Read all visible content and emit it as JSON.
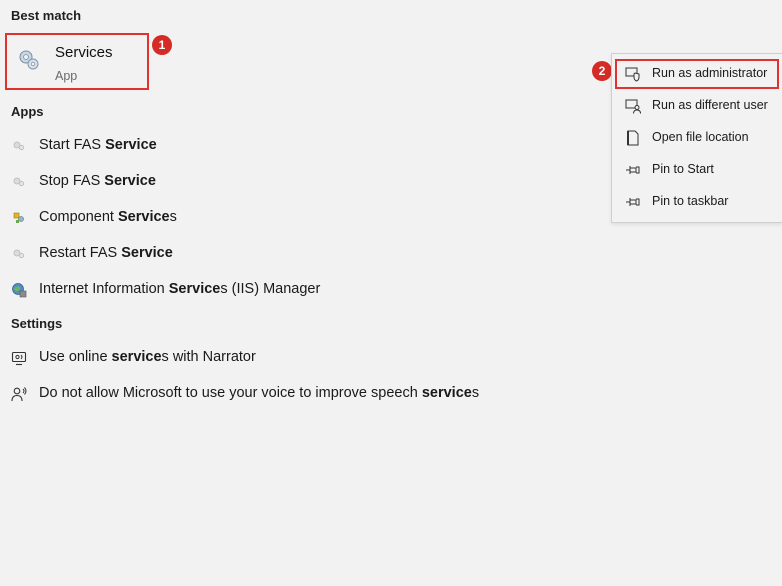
{
  "headers": {
    "best_match": "Best match",
    "apps": "Apps",
    "settings": "Settings"
  },
  "best_match": {
    "title": "Services",
    "subtitle": "App",
    "icon": "services-gear-icon"
  },
  "annotations": {
    "step1": "1",
    "step2": "2"
  },
  "apps": [
    {
      "pre": "Start FAS ",
      "bold": "Service",
      "post": "",
      "icon": "service-app-icon"
    },
    {
      "pre": "Stop FAS ",
      "bold": "Service",
      "post": "",
      "icon": "service-app-icon"
    },
    {
      "pre": "Component ",
      "bold": "Service",
      "post": "s",
      "icon": "component-services-icon"
    },
    {
      "pre": "Restart FAS ",
      "bold": "Service",
      "post": "",
      "icon": "service-app-icon"
    },
    {
      "pre": "Internet Information ",
      "bold": "Service",
      "post": "s (IIS) Manager",
      "icon": "iis-manager-icon"
    }
  ],
  "settings": [
    {
      "pre": "Use online ",
      "bold": "service",
      "post": "s with Narrator",
      "icon": "narrator-icon"
    },
    {
      "pre": "Do not allow Microsoft to use your voice to improve speech ",
      "bold": "service",
      "post": "s",
      "icon": "speech-icon"
    }
  ],
  "context_menu": [
    {
      "label": "Run as administrator",
      "icon": "shield-icon"
    },
    {
      "label": "Run as different user",
      "icon": "user-icon"
    },
    {
      "label": "Open file location",
      "icon": "file-location-icon"
    },
    {
      "label": "Pin to Start",
      "icon": "pin-icon"
    },
    {
      "label": "Pin to taskbar",
      "icon": "pin-icon"
    }
  ],
  "colors": {
    "background": "#f2f2f2",
    "highlight_border": "#e0322e",
    "badge": "#d52b26"
  }
}
